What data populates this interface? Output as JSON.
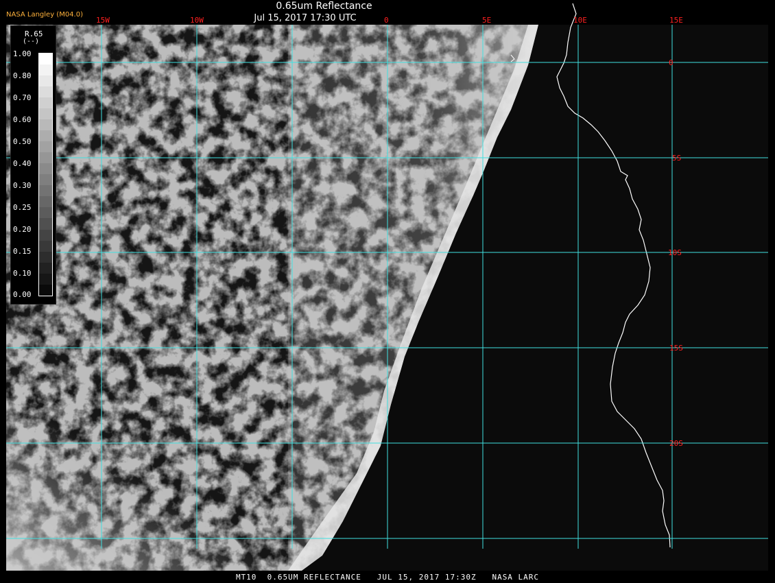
{
  "header": {
    "credit": "NASA Langley (M04.0)",
    "title": "0.65um Reflectance",
    "timestamp": "Jul 15, 2017 17:30 UTC"
  },
  "legend": {
    "title": "R.65",
    "units": "(--)",
    "ticks": [
      "1.00",
      "0.80",
      "0.70",
      "0.60",
      "0.50",
      "0.40",
      "0.30",
      "0.25",
      "0.20",
      "0.15",
      "0.10",
      "0.00"
    ]
  },
  "map": {
    "longitude_labels": [
      "15W",
      "10W",
      "0",
      "5E",
      "10E",
      "15E"
    ],
    "latitude_labels": [
      "0",
      "5S",
      "10S",
      "15S",
      "20S"
    ],
    "colors": {
      "grid": "#40e0e0",
      "labels": "#ff2020",
      "coast": "#ffffff",
      "ocean": "#0b0b0b"
    }
  },
  "footer": {
    "caption": "MT10  0.65UM REFLECTANCE   JUL 15, 2017 17:30Z   NASA LARC"
  }
}
